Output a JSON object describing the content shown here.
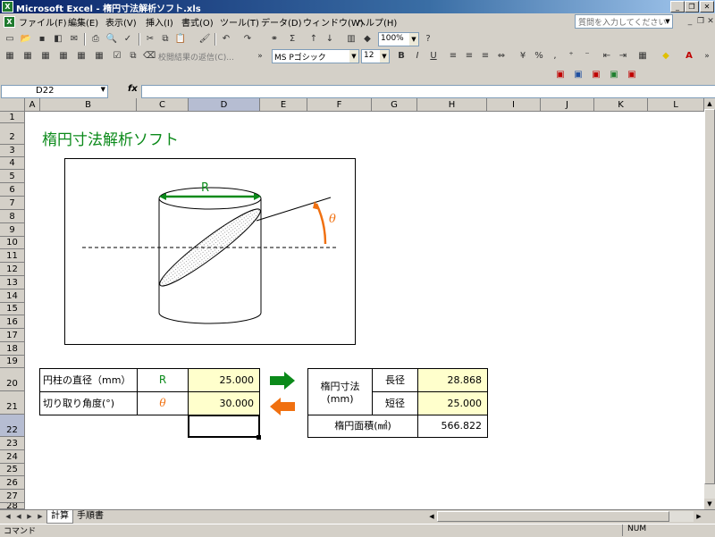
{
  "window": {
    "title": "Microsoft Excel - 楕円寸法解析ソフト.xls",
    "app_icon": "excel-icon"
  },
  "menu": [
    "ファイル(F)",
    "編集(E)",
    "表示(V)",
    "挿入(I)",
    "書式(O)",
    "ツール(T)",
    "データ(D)",
    "ウィンドウ(W)",
    "ヘルプ(H)"
  ],
  "help_search": {
    "placeholder": "質問を入力してください"
  },
  "toolbar": {
    "zoom": "100%",
    "review_label": "校閲結果の返信(C)...",
    "font_name": "MS Pゴシック",
    "font_size": "12"
  },
  "formula_bar": {
    "name_box": "D22",
    "fx": "fx",
    "formula": ""
  },
  "columns": [
    "A",
    "B",
    "C",
    "D",
    "E",
    "F",
    "G",
    "H",
    "I",
    "J",
    "K",
    "L"
  ],
  "rows": [
    "1",
    "2",
    "3",
    "4",
    "5",
    "6",
    "7",
    "8",
    "9",
    "10",
    "11",
    "12",
    "13",
    "14",
    "15",
    "16",
    "17",
    "18",
    "19",
    "20",
    "21",
    "22",
    "23",
    "24",
    "25",
    "26",
    "27",
    "28"
  ],
  "sheet": {
    "title": "楕円寸法解析ソフト",
    "diagram": {
      "radius_label": "R",
      "angle_label": "θ"
    },
    "inputs": [
      {
        "label": "円柱の直径（mm）",
        "symbol": "R",
        "value": "25.000"
      },
      {
        "label": "切り取り角度(°)",
        "symbol": "θ",
        "value": "30.000"
      }
    ],
    "results": {
      "group_label_1": "楕円寸法",
      "group_label_2": "(mm)",
      "long_label": "長径",
      "long_value": "28.868",
      "short_label": "短径",
      "short_value": "25.000",
      "area_label": "楕円面積(㎟)",
      "area_value": "566.822"
    },
    "colors": {
      "title": "#0b8a1a",
      "symbol_r": "#0b8a1a",
      "symbol_theta": "#f07010",
      "input_fill": "#ffffcc",
      "arrow_right": "#0b8a1a",
      "arrow_left": "#f07010"
    }
  },
  "tabs": [
    {
      "label": "計算",
      "active": true
    },
    {
      "label": "手順書",
      "active": false
    }
  ],
  "status": {
    "left": "コマンド",
    "right": "NUM"
  }
}
